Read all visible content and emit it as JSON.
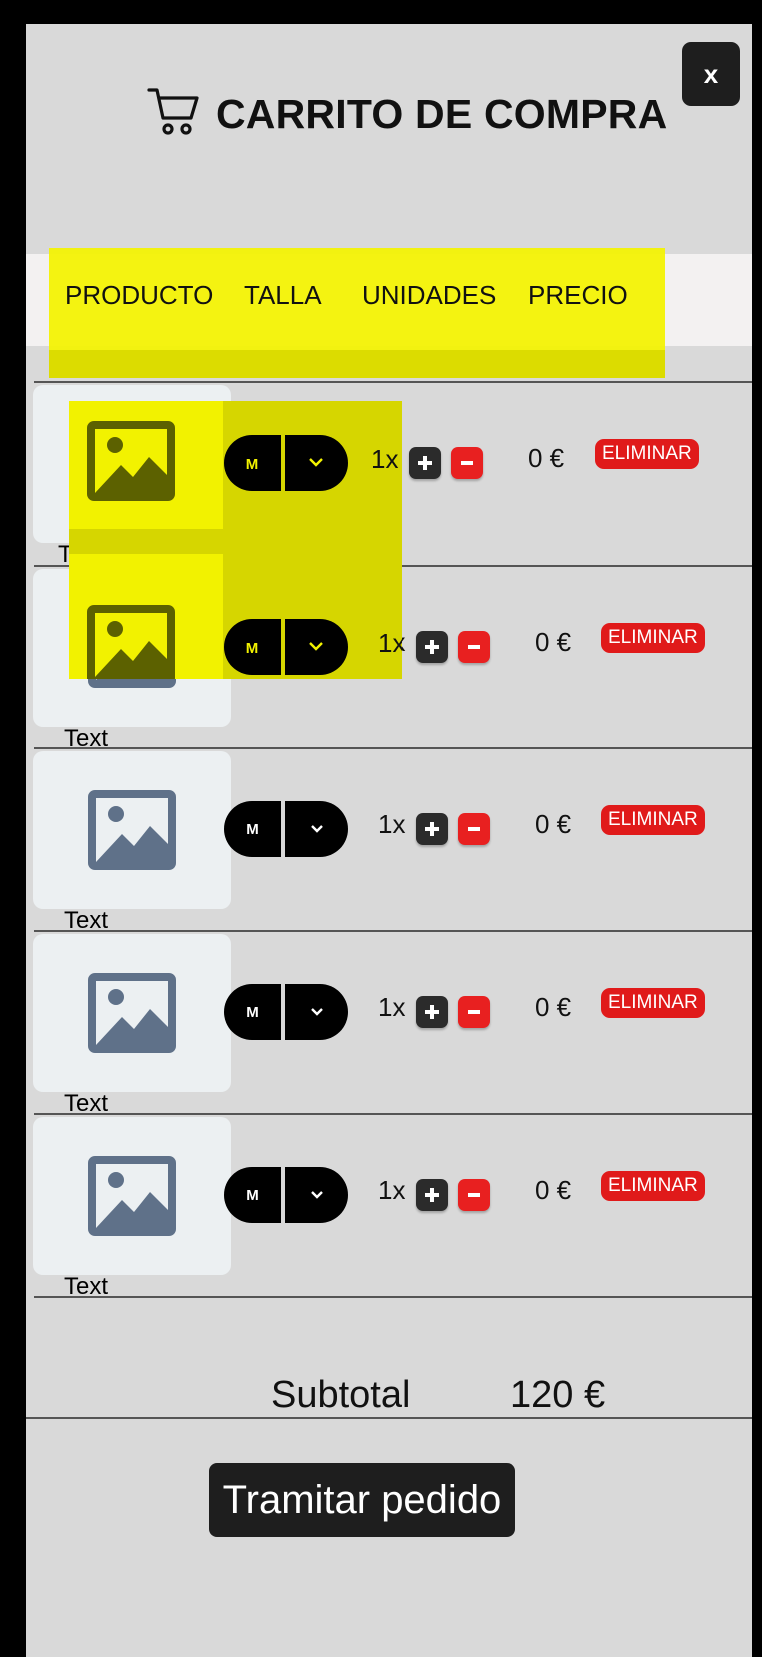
{
  "header": {
    "title": "CARRITO DE COMPRA",
    "cart_icon": "shopping-cart-icon",
    "close_label": "x"
  },
  "columns": [
    "PRODUCTO",
    "TALLA",
    "UNIDADES",
    "PRECIO"
  ],
  "items": [
    {
      "name": "Text",
      "size": "M",
      "quantity": "1x",
      "price": "0 €",
      "remove_label": "ELIMINAR"
    },
    {
      "name": "Text",
      "size": "M",
      "quantity": "1x",
      "price": "0 €",
      "remove_label": "ELIMINAR"
    },
    {
      "name": "Text",
      "size": "M",
      "quantity": "1x",
      "price": "0 €",
      "remove_label": "ELIMINAR"
    },
    {
      "name": "Text",
      "size": "M",
      "quantity": "1x",
      "price": "0 €",
      "remove_label": "ELIMINAR"
    },
    {
      "name": "Text",
      "size": "M",
      "quantity": "1x",
      "price": "0 €",
      "remove_label": "ELIMINAR"
    }
  ],
  "summary": {
    "subtotal_label": "Subtotal",
    "subtotal_value": "120 €"
  },
  "checkout_label": "Tramitar pedido",
  "colors": {
    "panel": "#d9d9d9",
    "highlight": "#f3f300",
    "danger": "#e01a1a",
    "dark": "#1e1e1e",
    "placeholder_icon": "#5f7189"
  }
}
